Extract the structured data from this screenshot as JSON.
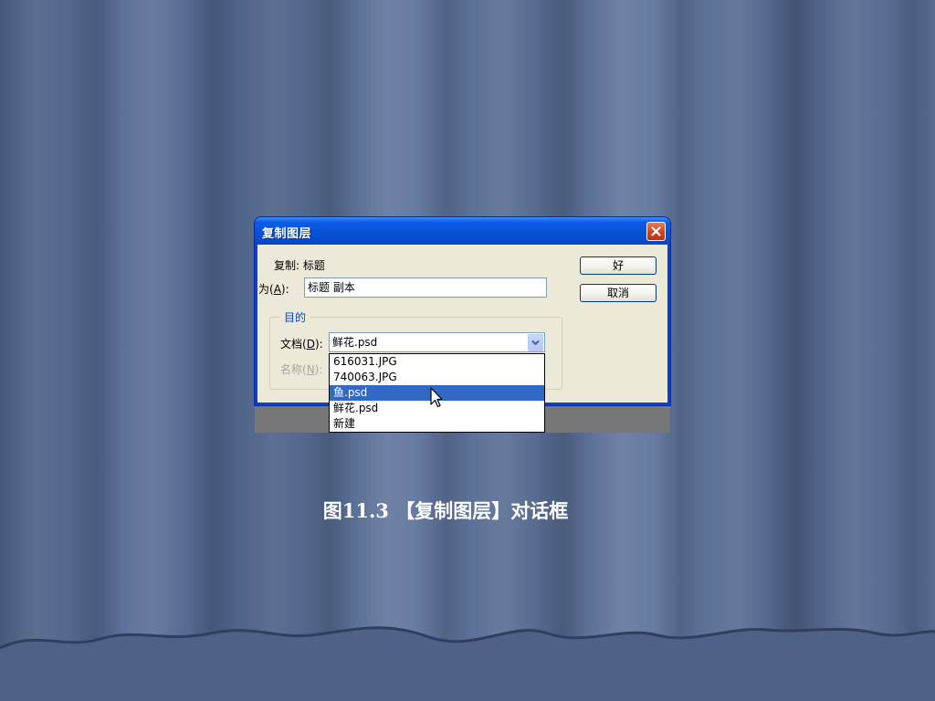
{
  "dialog": {
    "title": "复制图层",
    "source_prefix": "复制:",
    "source_value": "标题",
    "as_label_prefix": "为(",
    "as_label_hotkey": "A",
    "as_label_suffix": "):",
    "as_value": "标题 副本",
    "ok_label": "好",
    "cancel_label": "取消",
    "group_title": "目的",
    "document_label_prefix": "文档(",
    "document_label_hotkey": "D",
    "document_label_suffix": "):",
    "document_value": "鲜花.psd",
    "name_label_prefix": "名称(",
    "name_label_hotkey": "N",
    "name_label_suffix": "):",
    "document_options": [
      "616031.JPG",
      "740063.JPG",
      "鱼.psd",
      "鲜花.psd",
      "新建"
    ],
    "highlighted_option_index": 2
  },
  "caption": "图11.3 【复制图层】对话框",
  "icons": {
    "close": "close-icon",
    "dropdown": "chevron-down-icon",
    "cursor": "mouse-pointer-icon"
  },
  "colors": {
    "titlebar": "#0353d8",
    "dialog_body": "#ece9d8",
    "selection": "#316ac5",
    "group_title": "#0046d5",
    "close_button": "#d5401b"
  }
}
